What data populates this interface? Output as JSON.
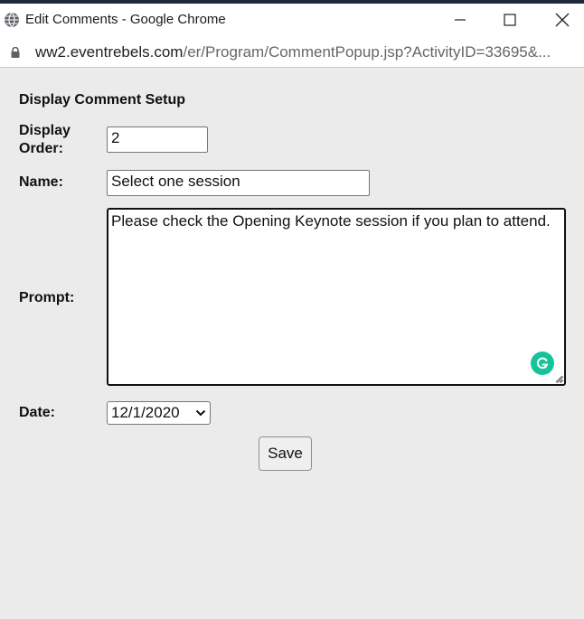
{
  "window": {
    "title": "Edit Comments - Google Chrome",
    "url_host": "ww2.eventrebels.com",
    "url_path": "/er/Program/CommentPopup.jsp?ActivityID=33695&..."
  },
  "form": {
    "heading": "Display Comment Setup",
    "display_order_label_line1": "Display",
    "display_order_label_line2": "Order:",
    "display_order_value": "2",
    "name_label": "Name:",
    "name_value": "Select one session",
    "prompt_label": "Prompt:",
    "prompt_value": "Please check the Opening Keynote session if you plan to attend.",
    "date_label": "Date:",
    "date_value": "12/1/2020",
    "save_label": "Save"
  },
  "colors": {
    "page_bg": "#ebebeb",
    "grammarly": "#15c39a"
  }
}
